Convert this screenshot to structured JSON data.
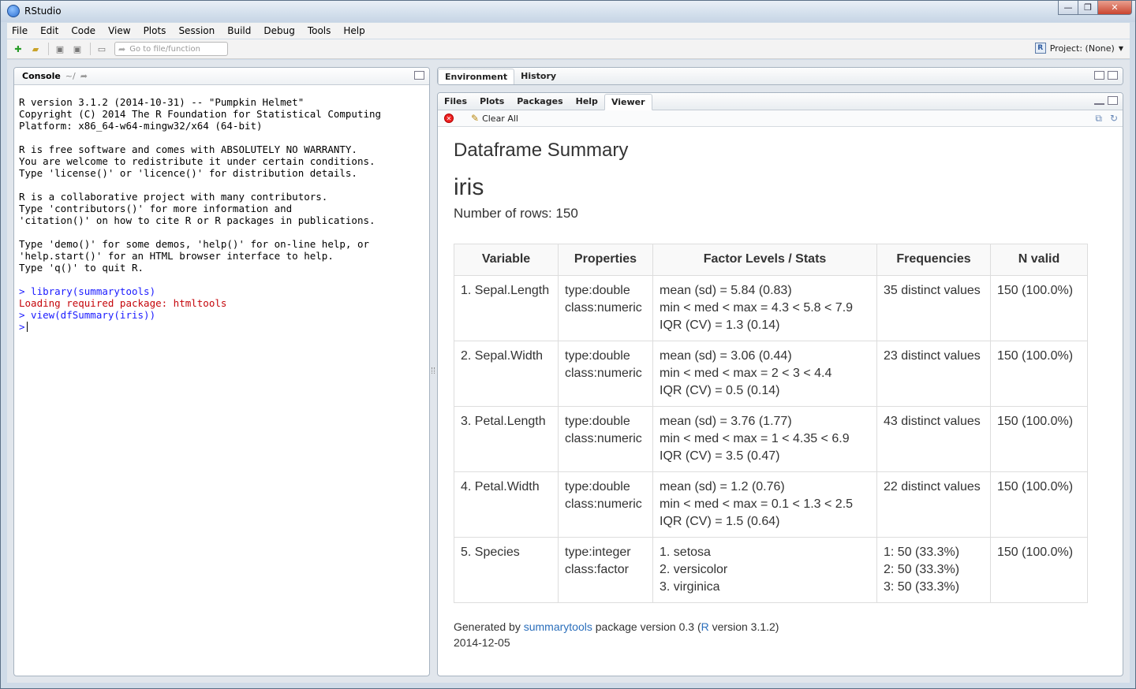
{
  "window": {
    "title": "RStudio",
    "controls": [
      "—",
      "❐",
      "✕"
    ]
  },
  "menu": [
    "File",
    "Edit",
    "Code",
    "View",
    "Plots",
    "Session",
    "Build",
    "Debug",
    "Tools",
    "Help"
  ],
  "toolbar": {
    "goto_placeholder": "Go to file/function",
    "project_label": "Project: (None)"
  },
  "console": {
    "title": "Console",
    "path": "~/",
    "lines": [
      {
        "text": "R version 3.1.2 (2014-10-31) -- \"Pumpkin Helmet\"",
        "style": ""
      },
      {
        "text": "Copyright (C) 2014 The R Foundation for Statistical Computing",
        "style": ""
      },
      {
        "text": "Platform: x86_64-w64-mingw32/x64 (64-bit)",
        "style": ""
      },
      {
        "text": "",
        "style": ""
      },
      {
        "text": "R is free software and comes with ABSOLUTELY NO WARRANTY.",
        "style": ""
      },
      {
        "text": "You are welcome to redistribute it under certain conditions.",
        "style": ""
      },
      {
        "text": "Type 'license()' or 'licence()' for distribution details.",
        "style": ""
      },
      {
        "text": "",
        "style": ""
      },
      {
        "text": "R is a collaborative project with many contributors.",
        "style": ""
      },
      {
        "text": "Type 'contributors()' for more information and",
        "style": ""
      },
      {
        "text": "'citation()' on how to cite R or R packages in publications.",
        "style": ""
      },
      {
        "text": "",
        "style": ""
      },
      {
        "text": "Type 'demo()' for some demos, 'help()' for on-line help, or",
        "style": ""
      },
      {
        "text": "'help.start()' for an HTML browser interface to help.",
        "style": ""
      },
      {
        "text": "Type 'q()' to quit R.",
        "style": ""
      },
      {
        "text": "",
        "style": ""
      },
      {
        "text": "> library(summarytools)",
        "style": "blue"
      },
      {
        "text": "Loading required package: htmltools",
        "style": "red"
      },
      {
        "text": "> view(dfSummary(iris))",
        "style": "blue"
      }
    ],
    "prompt": ">"
  },
  "env_tabs": [
    "Environment",
    "History"
  ],
  "viewer_tabs": [
    "Files",
    "Plots",
    "Packages",
    "Help",
    "Viewer"
  ],
  "viewer_tools": {
    "clear_all": "Clear All"
  },
  "report": {
    "heading": "Dataframe Summary",
    "dataset": "iris",
    "rows_text": "Number of rows: 150",
    "columns": [
      "Variable",
      "Properties",
      "Factor Levels / Stats",
      "Frequencies",
      "N valid"
    ],
    "rows": [
      {
        "variable": "1. Sepal.Length",
        "properties": [
          "type:double",
          "class:numeric"
        ],
        "stats": [
          "mean (sd) = 5.84 (0.83)",
          "min < med < max = 4.3 < 5.8 < 7.9",
          "IQR (CV) = 1.3 (0.14)"
        ],
        "freq": [
          "35 distinct values"
        ],
        "nvalid": "150 (100.0%)"
      },
      {
        "variable": "2. Sepal.Width",
        "properties": [
          "type:double",
          "class:numeric"
        ],
        "stats": [
          "mean (sd) = 3.06 (0.44)",
          "min < med < max = 2 < 3 < 4.4",
          "IQR (CV) = 0.5 (0.14)"
        ],
        "freq": [
          "23 distinct values"
        ],
        "nvalid": "150 (100.0%)"
      },
      {
        "variable": "3. Petal.Length",
        "properties": [
          "type:double",
          "class:numeric"
        ],
        "stats": [
          "mean (sd) = 3.76 (1.77)",
          "min < med < max = 1 < 4.35 < 6.9",
          "IQR (CV) = 3.5 (0.47)"
        ],
        "freq": [
          "43 distinct values"
        ],
        "nvalid": "150 (100.0%)"
      },
      {
        "variable": "4. Petal.Width",
        "properties": [
          "type:double",
          "class:numeric"
        ],
        "stats": [
          "mean (sd) = 1.2 (0.76)",
          "min < med < max = 0.1 < 1.3 < 2.5",
          "IQR (CV) = 1.5 (0.64)"
        ],
        "freq": [
          "22 distinct values"
        ],
        "nvalid": "150 (100.0%)"
      },
      {
        "variable": "5. Species",
        "properties": [
          "type:integer",
          "class:factor"
        ],
        "stats": [
          "1. setosa",
          "2. versicolor",
          "3. virginica"
        ],
        "freq": [
          "1: 50 (33.3%)",
          "2: 50 (33.3%)",
          "3: 50 (33.3%)"
        ],
        "nvalid": "150 (100.0%)"
      }
    ],
    "footer": {
      "generated_by": "Generated by",
      "pkg_link": "summarytools",
      "pkg_version": "package version 0.3 (",
      "r_link": "R",
      "r_version": "version 3.1.2)",
      "date": "2014-12-05"
    }
  },
  "colors": {
    "link": "#2a6ebb",
    "console_command": "#1a1aff",
    "console_message": "#c5060b"
  }
}
